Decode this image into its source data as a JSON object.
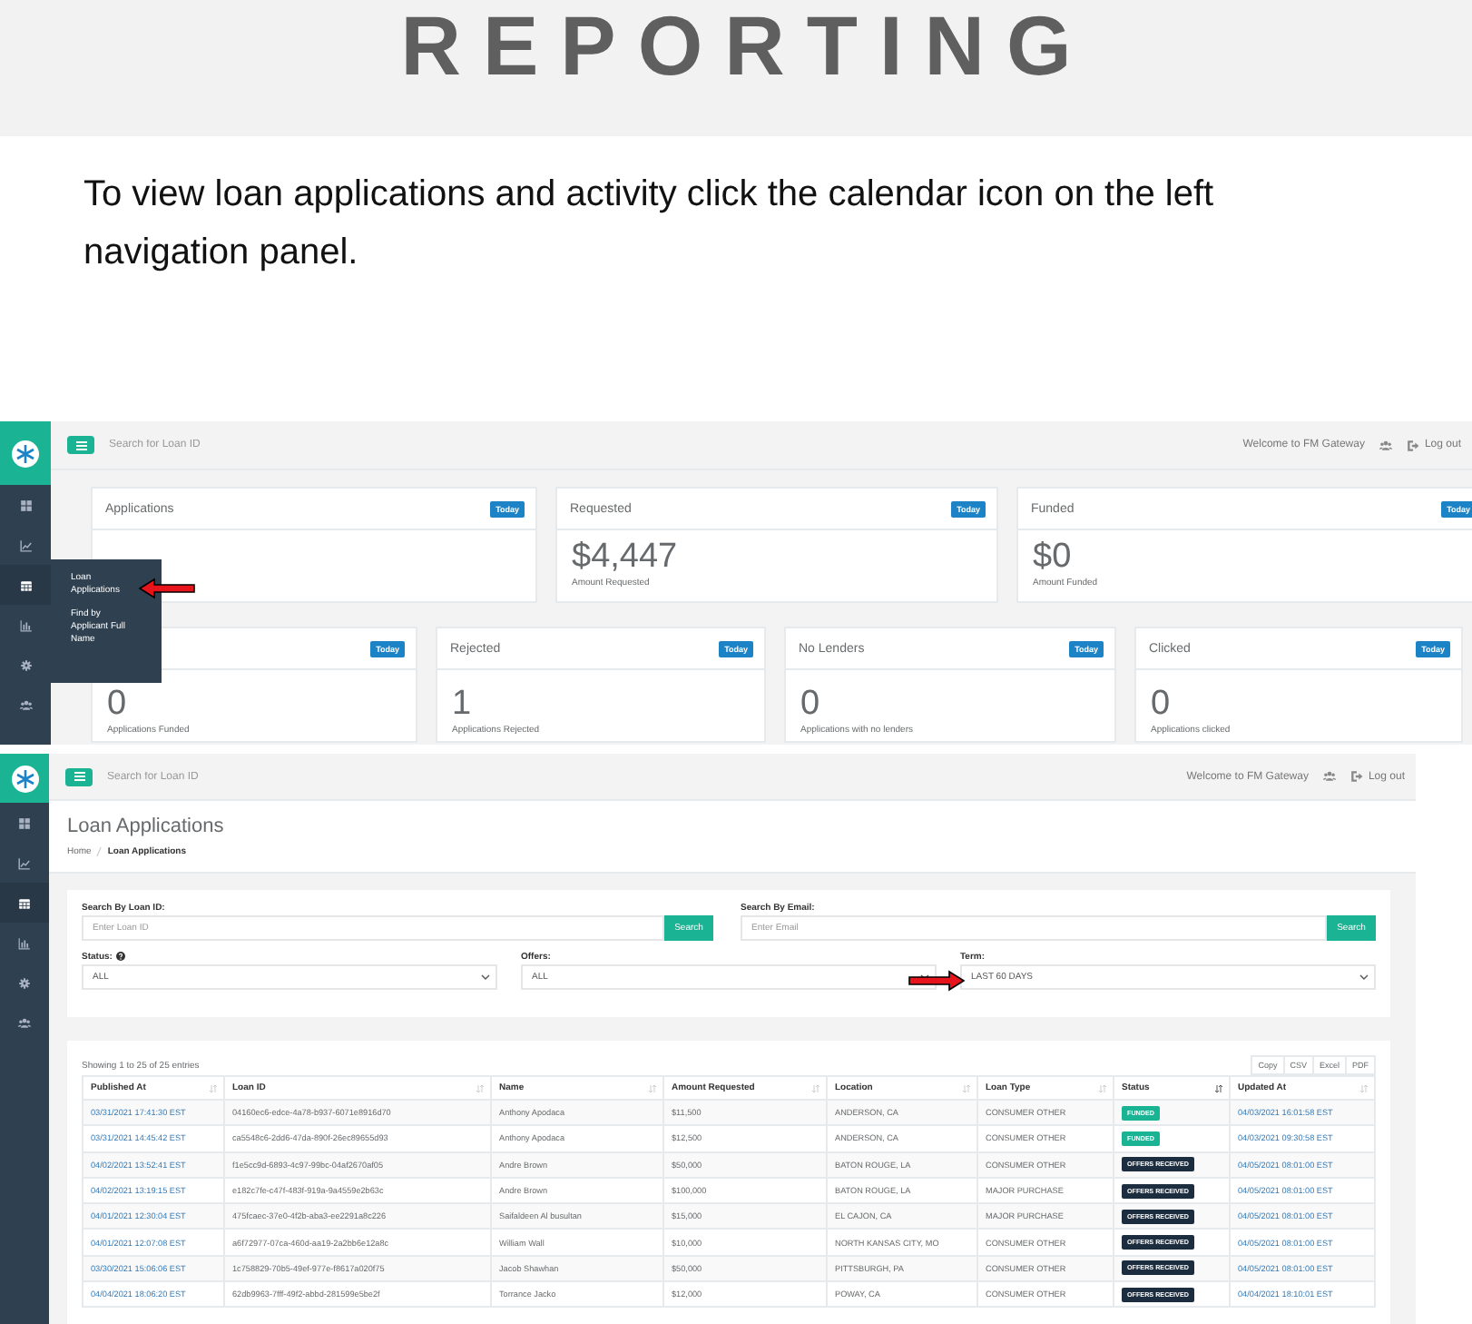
{
  "doc": {
    "heading": "REPORTING",
    "instructions": "To view loan applications and activity click the calendar icon on the left navigation panel."
  },
  "dashboard": {
    "topbar": {
      "search_placeholder": "Search for Loan ID",
      "welcome": "Welcome to FM Gateway",
      "logout": "Log out"
    },
    "sidebar": [
      {
        "selected": false
      },
      {
        "selected": false
      },
      {
        "selected": true
      },
      {
        "selected": false
      },
      {
        "selected": false
      },
      {
        "selected": false
      }
    ],
    "flyout": [
      "Loan Applications",
      "Find by Applicant Full Name"
    ],
    "cards_row1": [
      {
        "title": "Applications",
        "badge": "Today"
      },
      {
        "title": "Requested",
        "badge": "Today",
        "value": "$4,447",
        "caption": "Amount Requested"
      },
      {
        "title": "Funded",
        "badge": "Today",
        "value": "$0",
        "caption": "Amount Funded"
      }
    ],
    "cards_row2": [
      {
        "badge": "Today",
        "value": "0",
        "caption": "Applications Funded"
      },
      {
        "title": "Rejected",
        "badge": "Today",
        "value": "1",
        "caption": "Applications Rejected"
      },
      {
        "title": "No Lenders",
        "badge": "Today",
        "value": "0",
        "caption": "Applications with no lenders"
      },
      {
        "title": "Clicked",
        "badge": "Today",
        "value": "0",
        "caption": "Applications clicked"
      }
    ]
  },
  "applications": {
    "topbar": {
      "search_placeholder": "Search for Loan ID",
      "welcome": "Welcome to FM Gateway",
      "logout": "Log out"
    },
    "sidebar": [
      {
        "selected": false
      },
      {
        "selected": false
      },
      {
        "selected": true
      },
      {
        "selected": false
      },
      {
        "selected": false
      },
      {
        "selected": false
      }
    ],
    "title": "Loan Applications",
    "breadcrumb": [
      "Home",
      "Loan Applications"
    ],
    "filters": {
      "loan_id": {
        "label": "Search By Loan ID:",
        "placeholder": "Enter Loan ID",
        "button": "Search"
      },
      "email": {
        "label": "Search By Email:",
        "placeholder": "Enter Email",
        "button": "Search"
      },
      "selects": [
        {
          "label": "Status:",
          "help": true,
          "value": "ALL"
        },
        {
          "label": "Offers:",
          "help": false,
          "value": "ALL"
        },
        {
          "label": "Term:",
          "help": false,
          "value": "LAST 60 DAYS"
        }
      ]
    },
    "table": {
      "info": "Showing 1 to 25 of 25 entries",
      "export_buttons": [
        "Copy",
        "CSV",
        "Excel",
        "PDF"
      ],
      "columns": [
        {
          "label": "Published At",
          "sorted": false
        },
        {
          "label": "Loan ID",
          "sorted": false
        },
        {
          "label": "Name",
          "sorted": false
        },
        {
          "label": "Amount Requested",
          "sorted": false
        },
        {
          "label": "Location",
          "sorted": false
        },
        {
          "label": "Loan Type",
          "sorted": false
        },
        {
          "label": "Status",
          "sorted": true
        },
        {
          "label": "Updated At",
          "sorted": false
        }
      ],
      "rows": [
        {
          "published": "03/31/2021 17:41:30 EST",
          "loan_id": "04160ec6-edce-4a78-b937-6071e8916d70",
          "name": "Anthony Apodaca",
          "amount": "$11,500",
          "location": "ANDERSON, CA",
          "loan_type": "CONSUMER OTHER",
          "status": {
            "label": "FUNDED",
            "kind": "funded"
          },
          "updated": "04/03/2021 16:01:58 EST"
        },
        {
          "published": "03/31/2021 14:45:42 EST",
          "loan_id": "ca5548c6-2dd6-47da-890f-26ec89655d93",
          "name": "Anthony Apodaca",
          "amount": "$12,500",
          "location": "ANDERSON, CA",
          "loan_type": "CONSUMER OTHER",
          "status": {
            "label": "FUNDED",
            "kind": "funded"
          },
          "updated": "04/03/2021 09:30:58 EST"
        },
        {
          "published": "04/02/2021 13:52:41 EST",
          "loan_id": "f1e5cc9d-6893-4c97-99bc-04af2670af05",
          "name": "Andre Brown",
          "amount": "$50,000",
          "location": "BATON ROUGE, LA",
          "loan_type": "CONSUMER OTHER",
          "status": {
            "label": "OFFERS RECEIVED",
            "kind": "offers"
          },
          "updated": "04/05/2021 08:01:00 EST"
        },
        {
          "published": "04/02/2021 13:19:15 EST",
          "loan_id": "e182c7fe-c47f-483f-919a-9a4559e2b63c",
          "name": "Andre Brown",
          "amount": "$100,000",
          "location": "BATON ROUGE, LA",
          "loan_type": "MAJOR PURCHASE",
          "status": {
            "label": "OFFERS RECEIVED",
            "kind": "offers"
          },
          "updated": "04/05/2021 08:01:00 EST"
        },
        {
          "published": "04/01/2021 12:30:04 EST",
          "loan_id": "475fcaec-37e0-4f2b-aba3-ee2291a8c226",
          "name": "Saifaldeen Al busultan",
          "amount": "$15,000",
          "location": "EL CAJON, CA",
          "loan_type": "MAJOR PURCHASE",
          "status": {
            "label": "OFFERS RECEIVED",
            "kind": "offers"
          },
          "updated": "04/05/2021 08:01:00 EST"
        },
        {
          "published": "04/01/2021 12:07:08 EST",
          "loan_id": "a6f72977-07ca-460d-aa19-2a2bb6e12a8c",
          "name": "William Wall",
          "amount": "$10,000",
          "location": "NORTH KANSAS CITY, MO",
          "loan_type": "CONSUMER OTHER",
          "status": {
            "label": "OFFERS RECEIVED",
            "kind": "offers"
          },
          "updated": "04/05/2021 08:01:00 EST"
        },
        {
          "published": "03/30/2021 15:06:06 EST",
          "loan_id": "1c758829-70b5-49ef-977e-f8617a020f75",
          "name": "Jacob Shawhan",
          "amount": "$50,000",
          "location": "PITTSBURGH, PA",
          "loan_type": "CONSUMER OTHER",
          "status": {
            "label": "OFFERS RECEIVED",
            "kind": "offers"
          },
          "updated": "04/05/2021 08:01:00 EST"
        },
        {
          "published": "04/04/2021 18:06:20 EST",
          "loan_id": "62db9963-7fff-49f2-abbd-281599e5be2f",
          "name": "Torrance Jacko",
          "amount": "$12,000",
          "location": "POWAY, CA",
          "loan_type": "CONSUMER OTHER",
          "status": {
            "label": "OFFERS RECEIVED",
            "kind": "offers"
          },
          "updated": "04/04/2021 18:10:01 EST"
        }
      ]
    }
  }
}
